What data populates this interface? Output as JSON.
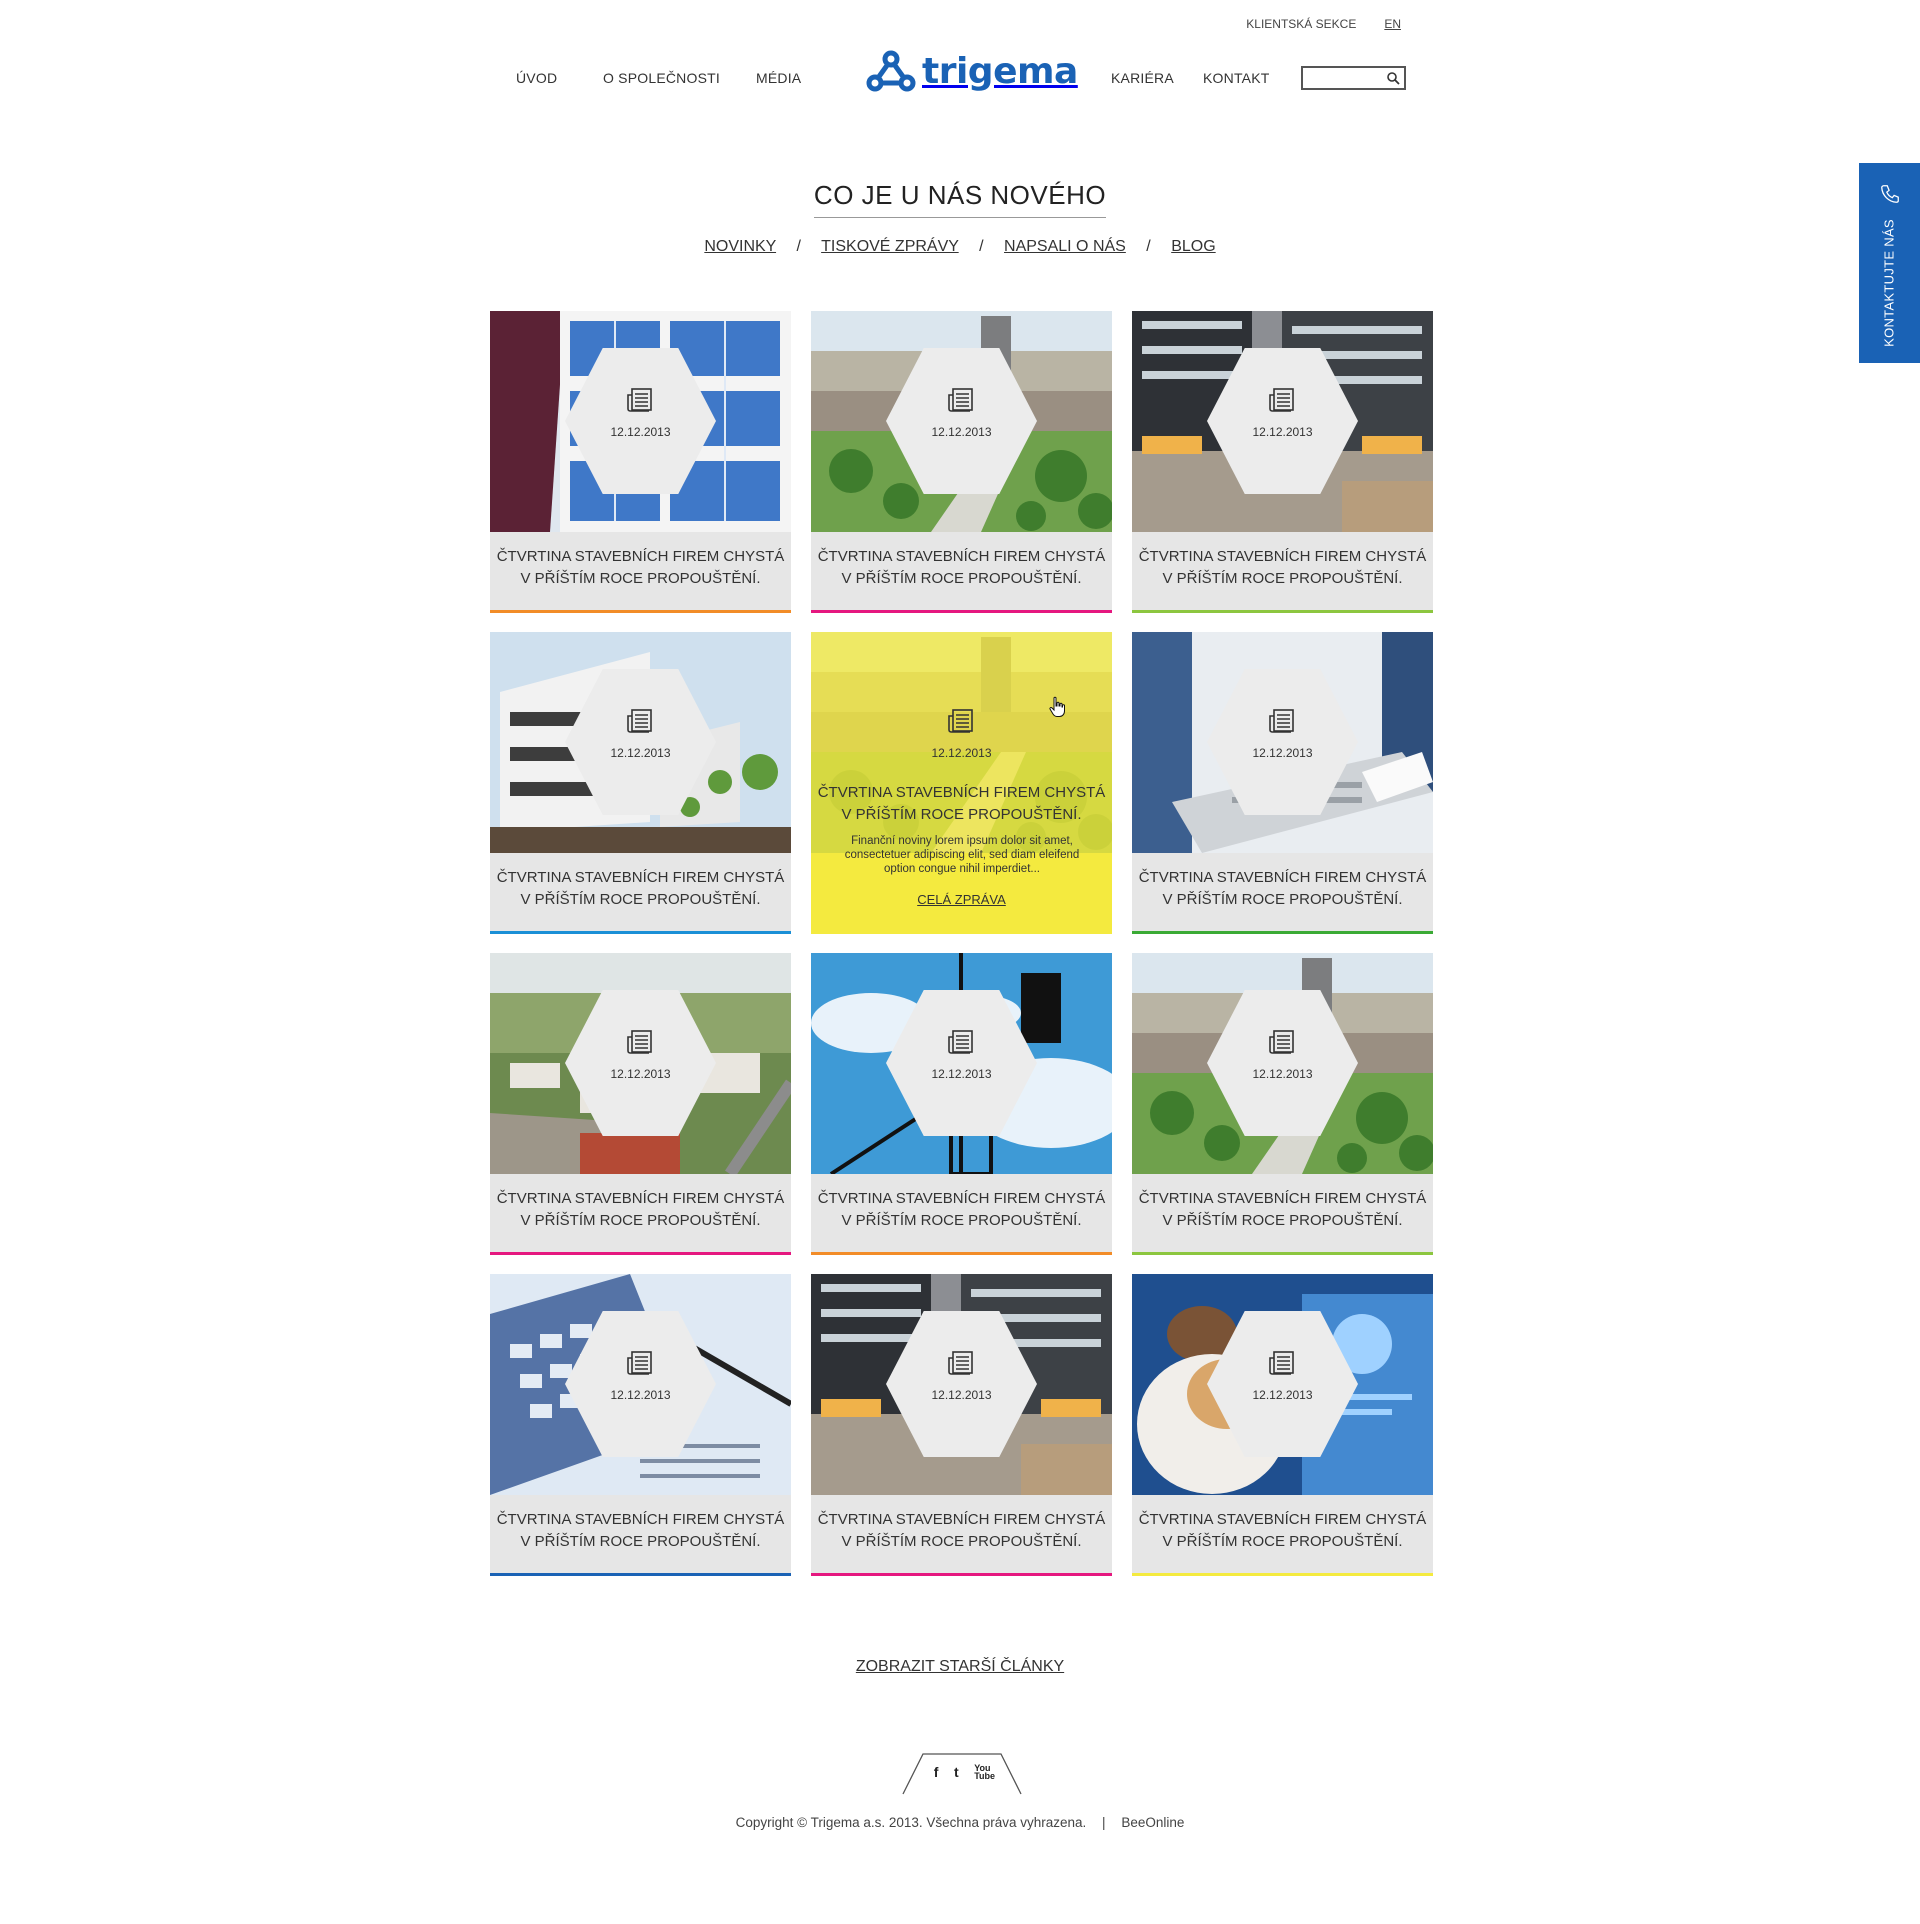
{
  "topbar": {
    "client_section": "KLIENTSKÁ SEKCE",
    "lang": "EN"
  },
  "nav": {
    "items_left": [
      "ÚVOD",
      "O SPOLEČNOSTI",
      "MÉDIA"
    ],
    "items_right": [
      "KARIÉRA",
      "KONTAKT"
    ],
    "logo_text": "trigema",
    "search_placeholder": ""
  },
  "contact_tab": {
    "label": "KONTAKTUJTE NÁS"
  },
  "heading": {
    "title": "CO JE U NÁS NOVÉHO"
  },
  "subnav": {
    "items": [
      "NOVINKY",
      "TISKOVÉ ZPRÁVY",
      "NAPSALI O NÁS",
      "BLOG"
    ],
    "separator": "/"
  },
  "cards": [
    {
      "date": "12.12.2013",
      "title_line1": "ČTVRTINA STAVEBNÍCH FIREM CHYSTÁ",
      "title_line2": "V PŘÍŠTÍM ROCE PROPOUŠTĚNÍ.",
      "accent": "#f28c28",
      "scene": "glass-building"
    },
    {
      "date": "12.12.2013",
      "title_line1": "ČTVRTINA STAVEBNÍCH FIREM CHYSTÁ",
      "title_line2": "V PŘÍŠTÍM ROCE PROPOUŠTĚNÍ.",
      "accent": "#e5177f",
      "scene": "city-park"
    },
    {
      "date": "12.12.2013",
      "title_line1": "ČTVRTINA STAVEBNÍCH FIREM CHYSTÁ",
      "title_line2": "V PŘÍŠTÍM ROCE PROPOUŠTĚNÍ.",
      "accent": "#8cc63f",
      "scene": "plaza-evening"
    },
    {
      "date": "12.12.2013",
      "title_line1": "ČTVRTINA STAVEBNÍCH FIREM CHYSTÁ",
      "title_line2": "V PŘÍŠTÍM ROCE PROPOUŠTĚNÍ.",
      "accent": "#1a8fd6",
      "scene": "white-building"
    },
    {
      "date": "12.12.2013",
      "title_line1": "ČTVRTINA STAVEBNÍCH FIREM CHYSTÁ",
      "title_line2": "V PŘÍŠTÍM ROCE PROPOUŠTĚNÍ.",
      "accent": "#f4ea3f",
      "scene": "city-park",
      "active": true,
      "excerpt": "Finanční noviny lorem ipsum dolor sit amet, consectetuer adipiscing elit, sed diam eleifend option congue nihil imperdiet...",
      "more": "CELÁ ZPRÁVA"
    },
    {
      "date": "12.12.2013",
      "title_line1": "ČTVRTINA STAVEBNÍCH FIREM CHYSTÁ",
      "title_line2": "V PŘÍŠTÍM ROCE PROPOUŠTĚNÍ.",
      "accent": "#3aaa35",
      "scene": "laptop"
    },
    {
      "date": "12.12.2013",
      "title_line1": "ČTVRTINA STAVEBNÍCH FIREM CHYSTÁ",
      "title_line2": "V PŘÍŠTÍM ROCE PROPOUŠTĚNÍ.",
      "accent": "#e5177f",
      "scene": "aerial-town"
    },
    {
      "date": "12.12.2013",
      "title_line1": "ČTVRTINA STAVEBNÍCH FIREM CHYSTÁ",
      "title_line2": "V PŘÍŠTÍM ROCE PROPOUŠTĚNÍ.",
      "accent": "#f28c28",
      "scene": "crane-sky"
    },
    {
      "date": "12.12.2013",
      "title_line1": "ČTVRTINA STAVEBNÍCH FIREM CHYSTÁ",
      "title_line2": "V PŘÍŠTÍM ROCE PROPOUŠTĚNÍ.",
      "accent": "#8cc63f",
      "scene": "city-park"
    },
    {
      "date": "12.12.2013",
      "title_line1": "ČTVRTINA STAVEBNÍCH FIREM CHYSTÁ",
      "title_line2": "V PŘÍŠTÍM ROCE PROPOUŠTĚNÍ.",
      "accent": "#1a62b5",
      "scene": "calculator"
    },
    {
      "date": "12.12.2013",
      "title_line1": "ČTVRTINA STAVEBNÍCH FIREM CHYSTÁ",
      "title_line2": "V PŘÍŠTÍM ROCE PROPOUŠTĚNÍ.",
      "accent": "#e5177f",
      "scene": "plaza-evening"
    },
    {
      "date": "12.12.2013",
      "title_line1": "ČTVRTINA STAVEBNÍCH FIREM CHYSTÁ",
      "title_line2": "V PŘÍŠTÍM ROCE PROPOUŠTĚNÍ.",
      "accent": "#f4ea3f",
      "scene": "people-screen"
    }
  ],
  "older_link": "ZOBRAZIT STARŠÍ ČLÁNKY",
  "social": {
    "icons": [
      "facebook-icon",
      "twitter-icon",
      "youtube-icon"
    ],
    "facebook": "f",
    "twitter": "t",
    "youtube": "You Tube"
  },
  "footer": {
    "copyright": "Copyright © Trigema a.s. 2013. Všechna práva vyhrazena.",
    "separator": "|",
    "credit": "BeeOnline"
  },
  "colors": {
    "brand": "#1a62b5",
    "card_bg": "#e6e6e6",
    "active_bg": "#f4ea3f"
  }
}
